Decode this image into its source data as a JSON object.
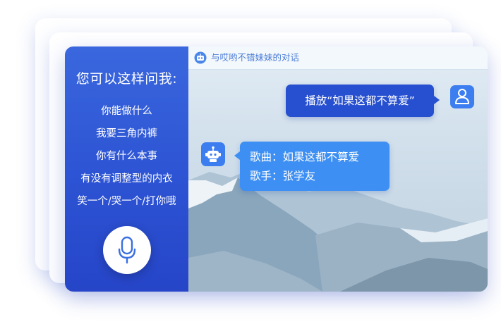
{
  "sidebar": {
    "title": "您可以这样问我:",
    "prompts": [
      "你能做什么",
      "我要三角内裤",
      "你有什么本事",
      "有没有调整型的内衣",
      "笑一个/哭一个/打你哦"
    ]
  },
  "chat": {
    "header_title": "与哎哟不错妹妹的对话",
    "user_message": "播放“如果这都不算爱”",
    "bot_reply": {
      "line1": "歌曲：如果这都不算爱",
      "line2": "歌手：张学友"
    }
  },
  "icons": {
    "mic": "microphone-icon",
    "bot": "robot-icon",
    "user": "user-icon"
  },
  "colors": {
    "sidebar": "#2c53d3",
    "user_bubble": "#2750d0",
    "bot_bubble": "#3d8ff3",
    "header_text": "#4d7ed8",
    "avatar": "#3c7ef0"
  }
}
